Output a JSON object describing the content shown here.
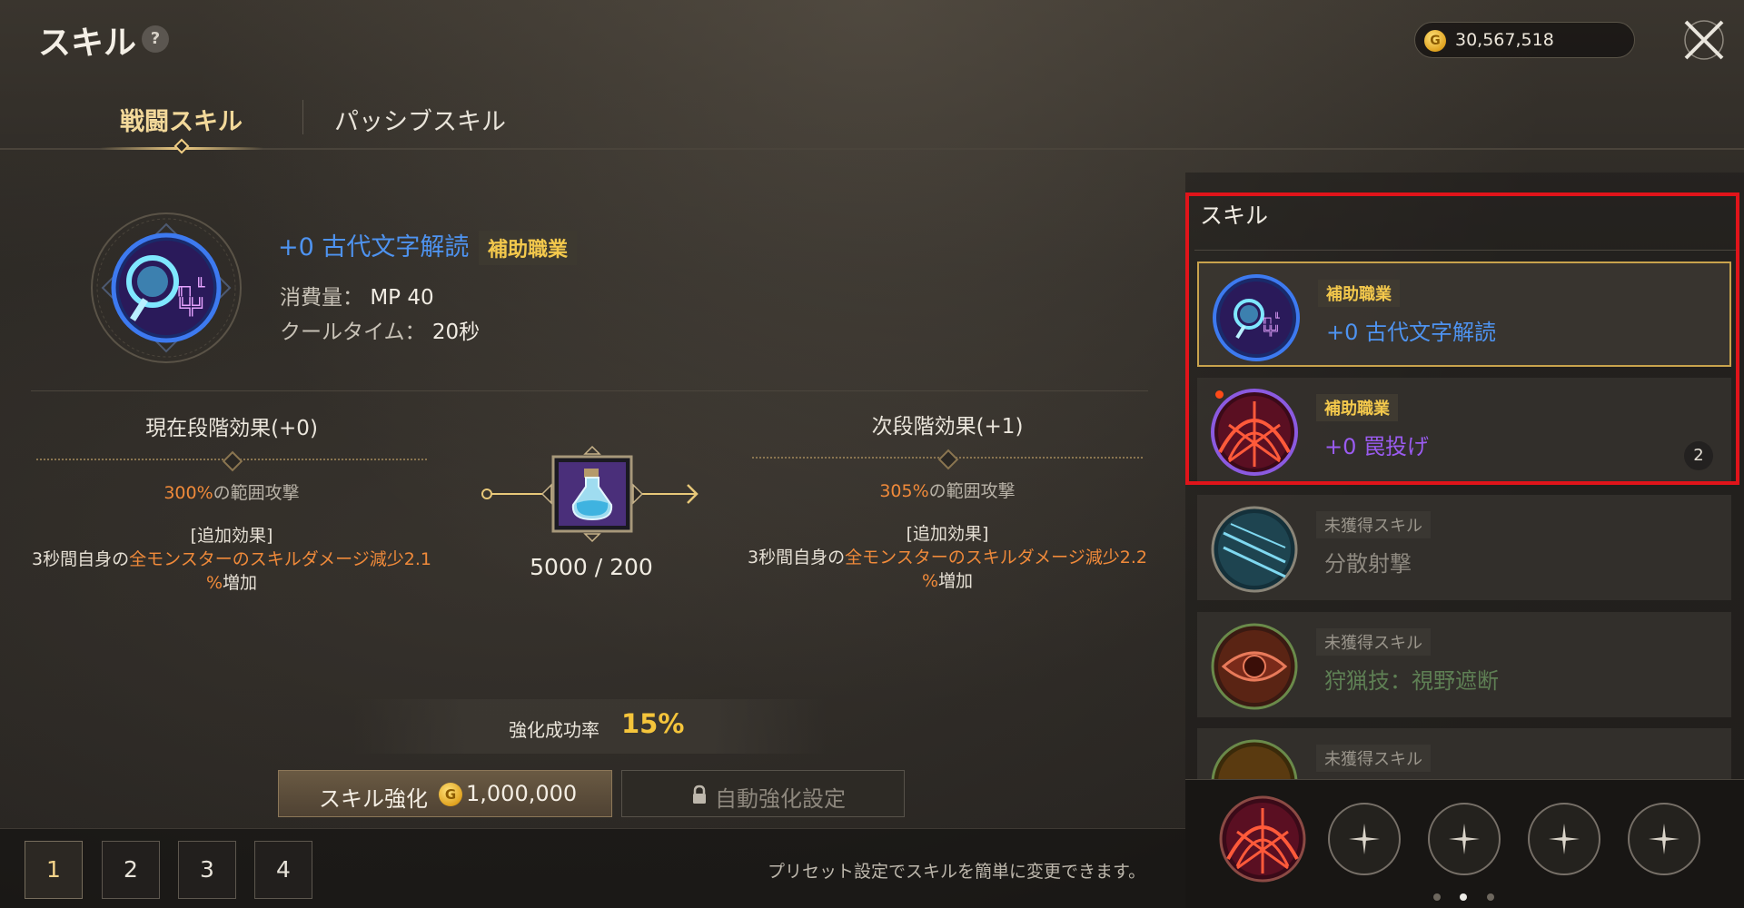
{
  "header": {
    "title": "スキル",
    "help": "?",
    "gold": "30,567,518"
  },
  "tabs": [
    {
      "label": "戦闘スキル",
      "active": true
    },
    {
      "label": "パッシブスキル",
      "active": false
    }
  ],
  "skill": {
    "name": "+0 古代文字解読",
    "tag": "補助職業",
    "cost_label": "消費量：",
    "cost_value": "MP 40",
    "cooldown_label": "クールタイム：",
    "cooldown_value": "20秒"
  },
  "current_effect": {
    "header": "現在段階効果(+0)",
    "pct": "300%",
    "aoe_suffix": "の範囲攻撃",
    "extra_title": "[追加効果]",
    "extra_pre": "3秒間自身の",
    "extra_hl": "全モンスターのスキルダメージ減少2.1",
    "extra_hl2": "%",
    "extra_post": "増加"
  },
  "next_effect": {
    "header": "次段階効果(+1)",
    "pct": "305%",
    "aoe_suffix": "の範囲攻撃",
    "extra_title": "[追加効果]",
    "extra_pre": "3秒間自身の",
    "extra_hl": "全モンスターのスキルダメージ減少2.2",
    "extra_hl2": "%",
    "extra_post": "増加"
  },
  "material": {
    "count": "5000 / 200",
    "icon": "potion-icon"
  },
  "success_rate": {
    "label": "強化成功率",
    "value": "15%"
  },
  "buttons": {
    "enhance_label": "スキル強化",
    "enhance_cost": "1,000,000",
    "auto_label": "自動強化設定"
  },
  "presets": [
    "1",
    "2",
    "3",
    "4"
  ],
  "preset_hint": "プリセット設定でスキルを簡単に変更できます。",
  "skill_list": {
    "title": "スキル",
    "items": [
      {
        "tag": "補助職業",
        "name": "+0 古代文字解読",
        "name_color": "#4e93f0",
        "selected": true
      },
      {
        "tag": "補助職業",
        "name": "+0 罠投げ",
        "name_color": "#9a5bf0",
        "count": "2",
        "new_dot": true
      },
      {
        "tag": "未獲得スキル",
        "name": "分散射撃",
        "name_color": "#8f8a81"
      },
      {
        "tag": "未獲得スキル",
        "name": "狩猟技：視野遮断",
        "name_color": "#5e7f54"
      },
      {
        "tag": "未獲得スキル",
        "name": ""
      }
    ]
  },
  "colors": {
    "accent_gold": "#f3c84c",
    "highlight_red": "#e0141a",
    "orange": "#f08a3a"
  }
}
